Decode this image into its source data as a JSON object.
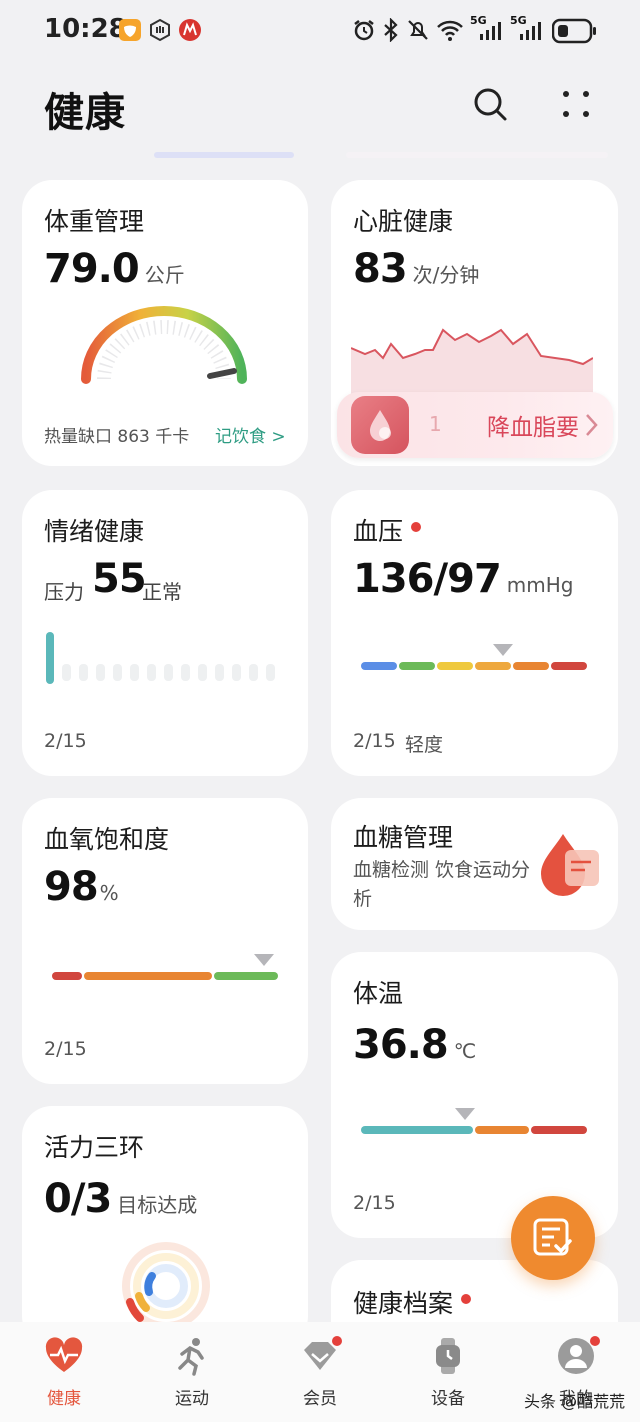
{
  "status_bar": {
    "time": "10:28",
    "network_1": "5G",
    "network_2": "5G"
  },
  "header": {
    "title": "健康"
  },
  "cards": {
    "weight": {
      "title": "体重管理",
      "value": "79.0",
      "unit": "公斤",
      "footer_text": "热量缺口 863 千卡",
      "link": "记饮食 >"
    },
    "heart": {
      "title": "心脏健康",
      "value": "83",
      "unit": "次/分钟",
      "promo_text": "降血脂要",
      "promo_partial": "1"
    },
    "mood": {
      "title": "情绪健康",
      "label": "压力",
      "value": "55",
      "status": "正常",
      "level_fraction": 0.05,
      "date": "2/15"
    },
    "blood_pressure": {
      "title": "血压",
      "value": "136/97",
      "unit": "mmHg",
      "date": "2/15",
      "status": "轻度"
    },
    "spo2": {
      "title": "血氧饱和度",
      "value": "98",
      "unit": "%",
      "date": "2/15"
    },
    "glucose": {
      "title": "血糖管理",
      "desc": "血糖检测 饮食运动分析"
    },
    "temperature": {
      "title": "体温",
      "value": "36.8",
      "unit": "℃",
      "date": "2/15"
    },
    "activity": {
      "title": "活力三环",
      "value": "0/3",
      "unit": "目标达成"
    },
    "records": {
      "title": "健康档案"
    }
  },
  "nav": {
    "items": [
      {
        "label": "健康",
        "icon": "heart-pulse-icon",
        "active": true
      },
      {
        "label": "运动",
        "icon": "running-icon",
        "active": false
      },
      {
        "label": "会员",
        "icon": "diamond-icon",
        "active": false
      },
      {
        "label": "设备",
        "icon": "watch-icon",
        "active": false
      },
      {
        "label": "我的",
        "icon": "profile-icon",
        "active": false
      }
    ]
  },
  "watermark": "头条 @酷荒荒",
  "colors": {
    "accent": "#e4573e",
    "fab": "#ef8a2f",
    "teal": "#5bb8ba",
    "alert_red": "#e4403b"
  }
}
